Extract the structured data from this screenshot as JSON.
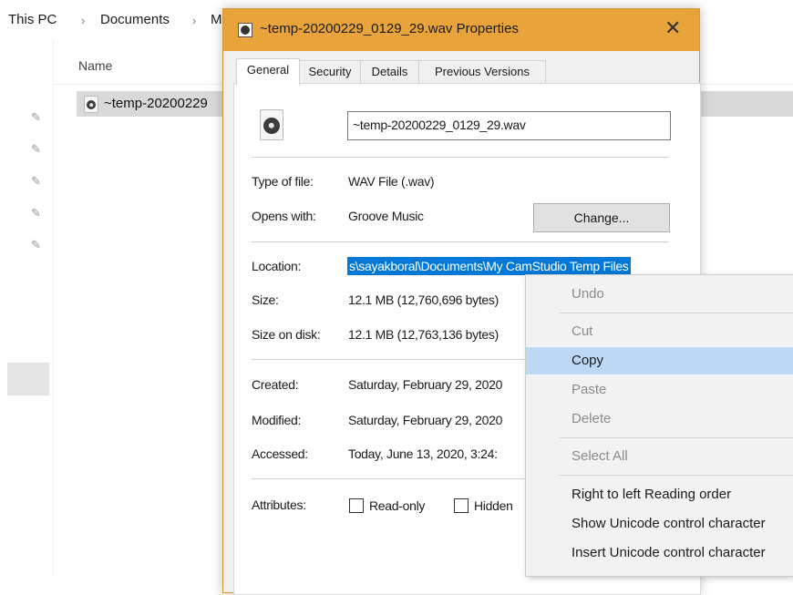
{
  "explorer": {
    "breadcrumb": [
      "This PC",
      "Documents",
      "M"
    ],
    "separator": "›",
    "column_name": "Name",
    "file_row_name": "~temp-20200229",
    "pin_glyph": "✎"
  },
  "dialog": {
    "title": "~temp-20200229_0129_29.wav Properties",
    "close_glyph": "✕",
    "tabs": [
      "General",
      "Security",
      "Details",
      "Previous Versions"
    ],
    "active_tab": "General",
    "filename": "~temp-20200229_0129_29.wav",
    "type_label": "Type of file:",
    "type_value": "WAV File (.wav)",
    "opens_label": "Opens with:",
    "opens_value": "Groove Music",
    "change_button": "Change...",
    "location_label": "Location:",
    "location_value": "s\\sayakboral\\Documents\\My CamStudio Temp Files",
    "size_label": "Size:",
    "size_value": "12.1 MB (12,760,696 bytes)",
    "size_disk_label": "Size on disk:",
    "size_disk_value": "12.1 MB (12,763,136 bytes)",
    "created_label": "Created:",
    "created_value": "Saturday, February 29, 2020",
    "modified_label": "Modified:",
    "modified_value": "Saturday, February 29, 2020",
    "accessed_label": "Accessed:",
    "accessed_value": "Today, June 13, 2020, 3:24:",
    "attributes_label": "Attributes:",
    "readonly_label": "Read-only",
    "hidden_label": "Hidden"
  },
  "context_menu": {
    "undo": "Undo",
    "cut": "Cut",
    "copy": "Copy",
    "paste": "Paste",
    "delete": "Delete",
    "select_all": "Select All",
    "rtl": "Right to left Reading order",
    "show_unicode": "Show Unicode control character",
    "insert_unicode": "Insert Unicode control character"
  },
  "colors": {
    "titlebar": "#e8a43a",
    "selection": "#0078d7",
    "menu_highlight": "#bdd8f5"
  }
}
